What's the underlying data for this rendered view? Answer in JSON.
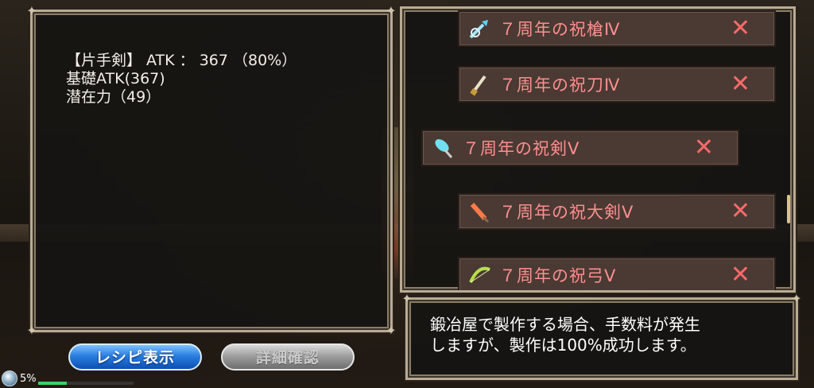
{
  "stats": {
    "line1": "【片手剣】 ATK ： 367 （80%）",
    "line2": "基礎ATK(367)",
    "line3": "潜在力（49）"
  },
  "items": [
    {
      "name": "７周年の祝槍Ⅳ",
      "icon": "spear-icon",
      "remove": "✕"
    },
    {
      "name": "７周年の祝刀Ⅳ",
      "icon": "katana-icon",
      "remove": "✕"
    },
    {
      "name": "７周年の祝剣Ⅴ",
      "icon": "sword-icon",
      "remove": "✕"
    },
    {
      "name": "７周年の祝大剣Ⅴ",
      "icon": "greatsword-icon",
      "remove": "✕"
    },
    {
      "name": "７周年の祝弓Ⅴ",
      "icon": "bow-icon",
      "remove": "✕"
    }
  ],
  "description": {
    "line1": "鍛冶屋で製作する場合、手数料が発生",
    "line2": "しますが、製作は100%成功します。"
  },
  "buttons": {
    "recipe": "レシピ表示",
    "detail": "詳細確認"
  },
  "status": {
    "percent": "5%",
    "progress": 0.3
  },
  "colors": {
    "item_text": "#ff8e8e",
    "remove_x": "#ff6a6a",
    "recipe_button": "#2a7fe0"
  }
}
